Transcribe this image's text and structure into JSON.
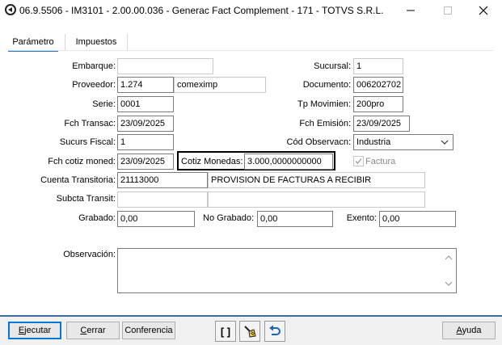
{
  "window": {
    "title": "06.9.5506 - IM3101 - 2.00.00.036 - Generac Fact Complement - 171 - TOTVS S.R.L."
  },
  "tabs": [
    {
      "label": "Parámetro",
      "active": true
    },
    {
      "label": "Impuestos",
      "active": false
    }
  ],
  "form": {
    "embarque": {
      "label": "Embarque:",
      "value": ""
    },
    "proveedor": {
      "label": "Proveedor:",
      "value": "1.274",
      "name": "comeximp"
    },
    "serie": {
      "label": "Serie:",
      "value": "0001"
    },
    "fch_transac": {
      "label": "Fch Transac:",
      "value": "23/09/2025"
    },
    "sucurs_fiscal": {
      "label": "Sucurs Fiscal:",
      "value": "1"
    },
    "fch_cotiz_moned": {
      "label": "Fch cotiz moned:",
      "value": "23/09/2025"
    },
    "cotiz_monedas": {
      "label": "Cotiz Monedas:",
      "value": "3.000,0000000000"
    },
    "cuenta_transitoria": {
      "label": "Cuenta Transitoria:",
      "value": "21113000",
      "description": "PROVISION DE FACTURAS A  RECIBIR"
    },
    "subcta_transit": {
      "label": "Subcta Transit:",
      "value": "",
      "description": ""
    },
    "grabado": {
      "label": "Grabado:",
      "value": "0,00"
    },
    "no_grabado": {
      "label": "No Grabado:",
      "value": "0,00"
    },
    "exento": {
      "label": "Exento:",
      "value": "0,00"
    },
    "sucursal": {
      "label": "Sucursal:",
      "value": "1"
    },
    "documento": {
      "label": "Documento:",
      "value": "006202702"
    },
    "tp_movimien": {
      "label": "Tp Movimien:",
      "value": "200pro"
    },
    "fch_emision": {
      "label": "Fch Emisión:",
      "value": "23/09/2025"
    },
    "cod_observacn": {
      "label": "Cód Observacn:",
      "value": "Industria"
    },
    "factura": {
      "label": "Factura",
      "checked": true
    },
    "observacion": {
      "label": "Observación:",
      "value": ""
    }
  },
  "buttons": {
    "ejecutar": {
      "accel": "E",
      "rest": "jecutar"
    },
    "cerrar": {
      "accel": "C",
      "rest": "errar"
    },
    "conferencia": "Conferencia",
    "brackets": "[ ]",
    "ayuda": {
      "pre": "",
      "accel": "A",
      "rest": "yuda"
    }
  },
  "colors": {
    "accent": "#0078d7",
    "bottom_separator": "#3a6ea5",
    "highlight_border": "#000000"
  },
  "icons": [
    "app-icon",
    "minimize-icon",
    "maximize-icon",
    "close-icon",
    "chevron-down-icon",
    "scroll-up-icon",
    "scroll-down-icon",
    "broom-icon",
    "undo-icon"
  ]
}
